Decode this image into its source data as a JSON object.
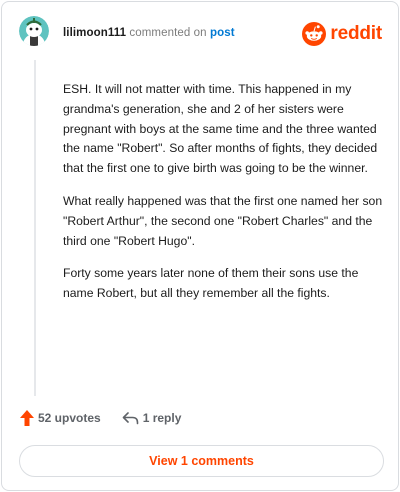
{
  "header": {
    "username": "lilimoon111",
    "action_text": "commented on",
    "post_link": "post",
    "brand": "reddit"
  },
  "comment": {
    "paragraphs": [
      "ESH. It will not matter with time. This happened in my grandma's generation, she and 2 of her sisters were pregnant with boys at the same time and the three wanted the name \"Robert\". So after months of fights, they decided that the first one to give birth was going to be the winner.",
      "What really happened was that the first one named her son \"Robert Arthur\", the second one \"Robert Charles\" and the third one \"Robert Hugo\".",
      "Forty some years later none of them their sons use the name Robert, but all they remember all the fights."
    ]
  },
  "actions": {
    "upvotes": "52 upvotes",
    "replies": "1 reply"
  },
  "footer": {
    "view_comments": "View 1 comments"
  },
  "colors": {
    "brand": "#ff4500",
    "link": "#0079d3",
    "avatar_bg": "#4fbdba"
  },
  "icons": {
    "avatar": "snoo-avatar-icon",
    "logo": "reddit-logo-icon",
    "upvote": "upvote-arrow-icon",
    "reply": "reply-arrow-icon"
  }
}
